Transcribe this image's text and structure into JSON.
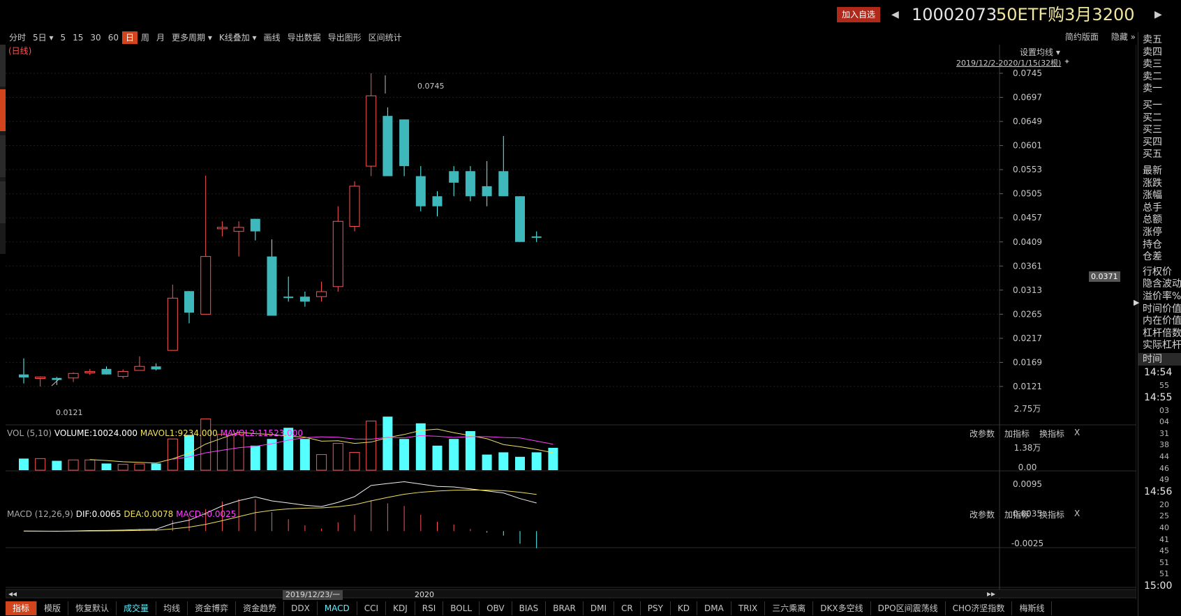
{
  "header": {
    "add_fav": "加入自选",
    "code": "10002073",
    "name": "50ETF购3月3200"
  },
  "toolbar": {
    "items": [
      "分时",
      "5日 ▾",
      "5",
      "15",
      "30",
      "60",
      "日",
      "周",
      "月",
      "更多周期 ▾",
      "K线叠加 ▾",
      "画线",
      "导出数据",
      "导出图形",
      "区间统计"
    ],
    "active_index": 6,
    "right_items": [
      "简约版面",
      "隐藏 »"
    ]
  },
  "main": {
    "label": "(日线)",
    "set_ma": "设置均线 ▾",
    "range": "2019/12/2-2020/1/15(32根)",
    "high_label": "0.0745",
    "low_label": "0.0121",
    "current_price": "0.0371",
    "y_ticks": [
      "0.0745",
      "0.0697",
      "0.0649",
      "0.0601",
      "0.0553",
      "0.0505",
      "0.0457",
      "0.0409",
      "0.0361",
      "0.0313",
      "0.0265",
      "0.0217",
      "0.0169",
      "0.0121"
    ]
  },
  "vol": {
    "name": "VOL (5,10)",
    "volume": "VOLUME:10024.000",
    "mavol1": "MAVOL1:9234.000",
    "mavol2": "MAVOL2:11523.000",
    "y_ticks": [
      "2.75万",
      "1.38万",
      "0.00"
    ],
    "buttons": [
      "改参数",
      "加指标",
      "换指标",
      "X"
    ]
  },
  "macd": {
    "name": "MACD (12,26,9)",
    "dif": "DIF:0.0065",
    "dea": "DEA:0.0078",
    "macd": "MACD:-0.0025",
    "y_ticks": [
      "0.0095",
      "0.0035",
      "-0.0025"
    ],
    "buttons": [
      "改参数",
      "加指标",
      "换指标",
      "X"
    ]
  },
  "xaxis": {
    "date1": "2019/12/23/一",
    "date2": "2020"
  },
  "right_panel": {
    "sell": [
      "卖五",
      "卖四",
      "卖三",
      "卖二",
      "卖一"
    ],
    "buy": [
      "买一",
      "买二",
      "买三",
      "买四",
      "买五"
    ],
    "stats": [
      "最新",
      "涨跌",
      "涨幅",
      "总手",
      "总额",
      "涨停",
      "持仓",
      "仓差"
    ],
    "option": [
      "行权价",
      "隐含波动率",
      "溢价率%",
      "时间价值",
      "内在价值",
      "杠杆倍数",
      "实际杠杆"
    ],
    "time_header": "时间",
    "times": [
      {
        "t": "14:54",
        "big": true
      },
      {
        "t": "55",
        "big": false
      },
      {
        "t": "14:55",
        "big": true
      },
      {
        "t": "03",
        "big": false
      },
      {
        "t": "04",
        "big": false
      },
      {
        "t": "31",
        "big": false
      },
      {
        "t": "38",
        "big": false
      },
      {
        "t": "44",
        "big": false
      },
      {
        "t": "46",
        "big": false
      },
      {
        "t": "49",
        "big": false
      },
      {
        "t": "14:56",
        "big": true
      },
      {
        "t": "20",
        "big": false
      },
      {
        "t": "25",
        "big": false
      },
      {
        "t": "40",
        "big": false
      },
      {
        "t": "41",
        "big": false
      },
      {
        "t": "45",
        "big": false
      },
      {
        "t": "51",
        "big": false
      },
      {
        "t": "51",
        "big": false
      },
      {
        "t": "15:00",
        "big": true
      }
    ]
  },
  "bottom_tabs": [
    "指标",
    "模版",
    "恢复默认",
    "成交量",
    "均线",
    "资金博弈",
    "资金趋势",
    "DDX",
    "MACD",
    "CCI",
    "KDJ",
    "RSI",
    "BOLL",
    "OBV",
    "BIAS",
    "BRAR",
    "DMI",
    "CR",
    "PSY",
    "KD",
    "DMA",
    "TRIX",
    "三六乘离",
    "DKX多空线",
    "DPO区间震荡线",
    "CHO济坚指数",
    "梅斯线"
  ],
  "chart_data": {
    "type": "candlestick",
    "y_range": [
      0.0121,
      0.0745
    ],
    "candles": [
      {
        "o": 0.0145,
        "c": 0.0139,
        "h": 0.0177,
        "l": 0.0127,
        "up": false
      },
      {
        "o": 0.014,
        "c": 0.0137,
        "h": 0.0141,
        "l": 0.0121,
        "up": true
      },
      {
        "o": 0.0138,
        "c": 0.0134,
        "h": 0.014,
        "l": 0.0124,
        "up": false
      },
      {
        "o": 0.0138,
        "c": 0.0147,
        "h": 0.0149,
        "l": 0.013,
        "up": true
      },
      {
        "o": 0.0151,
        "c": 0.0151,
        "h": 0.0156,
        "l": 0.0144,
        "up": true
      },
      {
        "o": 0.0156,
        "c": 0.0145,
        "h": 0.0161,
        "l": 0.0145,
        "up": false
      },
      {
        "o": 0.0141,
        "c": 0.0151,
        "h": 0.0155,
        "l": 0.0137,
        "up": true
      },
      {
        "o": 0.0153,
        "c": 0.0161,
        "h": 0.0181,
        "l": 0.0155,
        "up": true
      },
      {
        "o": 0.0161,
        "c": 0.0155,
        "h": 0.0167,
        "l": 0.0153,
        "up": false
      },
      {
        "o": 0.0193,
        "c": 0.0297,
        "h": 0.0324,
        "l": 0.0193,
        "up": true
      },
      {
        "o": 0.0311,
        "c": 0.0268,
        "h": 0.0311,
        "l": 0.0247,
        "up": false
      },
      {
        "o": 0.0265,
        "c": 0.038,
        "h": 0.0541,
        "l": 0.0265,
        "up": true
      },
      {
        "o": 0.0438,
        "c": 0.0438,
        "h": 0.045,
        "l": 0.042,
        "up": true
      },
      {
        "o": 0.0438,
        "c": 0.043,
        "h": 0.045,
        "l": 0.038,
        "up": true
      },
      {
        "o": 0.0455,
        "c": 0.043,
        "h": 0.0455,
        "l": 0.0412,
        "up": false
      },
      {
        "o": 0.038,
        "c": 0.0262,
        "h": 0.0414,
        "l": 0.0262,
        "up": false
      },
      {
        "o": 0.03,
        "c": 0.03,
        "h": 0.034,
        "l": 0.029,
        "up": false
      },
      {
        "o": 0.03,
        "c": 0.029,
        "h": 0.031,
        "l": 0.028,
        "up": false
      },
      {
        "o": 0.03,
        "c": 0.031,
        "h": 0.033,
        "l": 0.029,
        "up": true
      },
      {
        "o": 0.032,
        "c": 0.045,
        "h": 0.048,
        "l": 0.031,
        "up": true
      },
      {
        "o": 0.044,
        "c": 0.052,
        "h": 0.053,
        "l": 0.043,
        "up": true
      },
      {
        "o": 0.056,
        "c": 0.07,
        "h": 0.0745,
        "l": 0.054,
        "up": true
      },
      {
        "o": 0.066,
        "c": 0.054,
        "h": 0.0677,
        "l": 0.054,
        "up": false
      },
      {
        "o": 0.0653,
        "c": 0.056,
        "h": 0.0653,
        "l": 0.054,
        "up": false
      },
      {
        "o": 0.054,
        "c": 0.048,
        "h": 0.056,
        "l": 0.047,
        "up": false
      },
      {
        "o": 0.05,
        "c": 0.048,
        "h": 0.051,
        "l": 0.046,
        "up": false
      },
      {
        "o": 0.055,
        "c": 0.0527,
        "h": 0.056,
        "l": 0.05,
        "up": false
      },
      {
        "o": 0.055,
        "c": 0.05,
        "h": 0.056,
        "l": 0.049,
        "up": false
      },
      {
        "o": 0.052,
        "c": 0.05,
        "h": 0.057,
        "l": 0.048,
        "up": false
      },
      {
        "o": 0.055,
        "c": 0.05,
        "h": 0.062,
        "l": 0.05,
        "up": false
      },
      {
        "o": 0.05,
        "c": 0.0409,
        "h": 0.05,
        "l": 0.0409,
        "up": false
      },
      {
        "o": 0.042,
        "c": 0.0418,
        "h": 0.043,
        "l": 0.0409,
        "up": false
      }
    ],
    "volume": {
      "y_range": [
        0,
        27500
      ],
      "values": [
        5200,
        5200,
        4200,
        4600,
        4600,
        3000,
        2600,
        2800,
        3000,
        14000,
        15800,
        23000,
        16000,
        16000,
        11000,
        14000,
        19000,
        14000,
        7000,
        12000,
        8000,
        22000,
        24000,
        14000,
        21000,
        11000,
        14000,
        17500,
        7000,
        8000,
        6000,
        8000,
        10024
      ]
    }
  }
}
